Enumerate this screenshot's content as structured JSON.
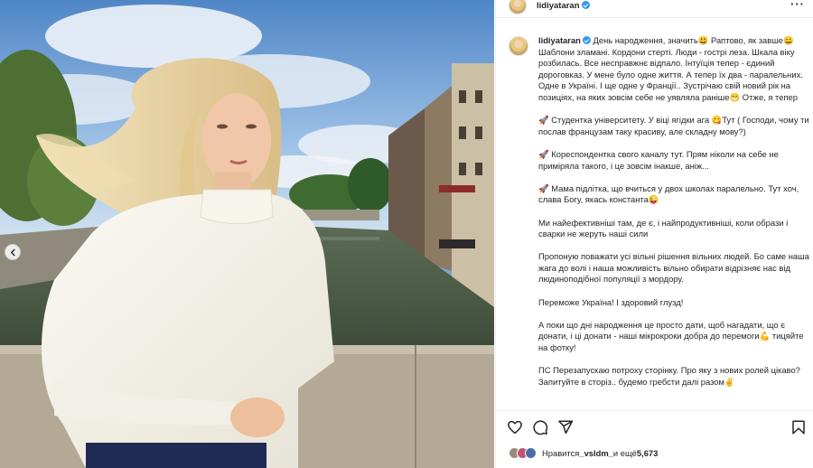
{
  "post": {
    "username": "lidiyataran",
    "more_label": "···"
  },
  "caption": {
    "username": "lidiyataran",
    "paragraphs": [
      "День народження, значить😃 Раптово, як завше😀 Шаблони зламані. Кордони стерті. Люди - гострі леза. Шкала віку розбилась. Все несправжнє відпало. Інтуїція тепер - єдиний дороговказ. У мене було одне життя. А тепер їх два - паралельних. Одне в Україні. І ще одне у Франції.. Зустрічаю свій новий рік на позиціях, на яких зовсім себе не уявляла раніше😁 Отже, я тепер",
      "🚀 Студентка університету. У віці ягідки ага 😋Тут ( Господи, чому ти послав французам таку красиву, але складну мову?)",
      "🚀 Кореспондентка свого каналу тут. Прям ніколи на себе не приміряла такого, і це зовсім інакше, аніж...",
      "🚀 Мама підлітка, що вчиться у двох школах паралельно. Тут хоч, слава Богу, якась константа😜",
      "Ми найефективніші там, де є, і найпродуктивніші, коли образи і сварки не жеруть наші сили",
      "Пропоную поважати усі вільні рішення вільних людей. Бо саме наша жага до волі і наша можливість вільно обирати відрізняє нас від людиноподібної популяції з мордору.",
      "Переможе Україна! І здоровий глузд!",
      "А поки що дні народження це просто дати, щоб нагадати, що є донати, і ці донати - наші мікрокроки добра до перемоги💪 тицяйте на фотку!",
      "ПС Перезапускаю потроху сторінку. Про яку з нових ролей цікаво? Запитуйте в сторіз.. будемо гребсти далі разом✌"
    ]
  },
  "likes": {
    "prefix": "Нравится ",
    "user": "_vsldm_",
    "suffix": " и ещё ",
    "count": "5,673"
  },
  "icons": [
    "heart-icon",
    "comment-icon",
    "share-icon",
    "bookmark-icon",
    "verified-badge-icon",
    "carousel-prev-icon"
  ]
}
